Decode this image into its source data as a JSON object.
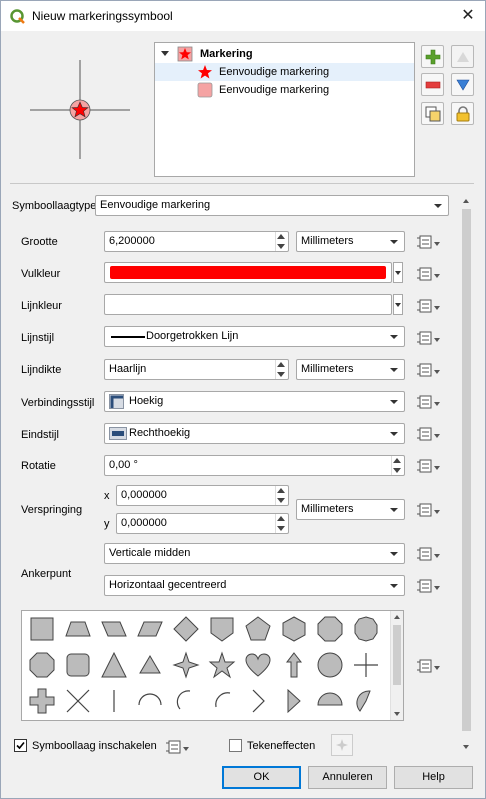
{
  "window": {
    "title": "Nieuw markeringssymbool",
    "close_glyph": "✕"
  },
  "tree": {
    "root": "Markering",
    "layers": [
      "Eenvoudige markering",
      "Eenvoudige markering"
    ]
  },
  "form": {
    "layer_type_label": "Symboollaagtype",
    "layer_type_value": "Eenvoudige markering",
    "size_label": "Grootte",
    "size_value": "6,200000",
    "size_unit": "Millimeters",
    "fill_color_label": "Vulkleur",
    "fill_color": "#ff0000",
    "stroke_color_label": "Lijnkleur",
    "stroke_style_label": "Lijnstijl",
    "stroke_style_value": "Doorgetrokken Lijn",
    "stroke_width_label": "Lijndikte",
    "stroke_width_value": "Haarlijn",
    "stroke_width_unit": "Millimeters",
    "join_style_label": "Verbindingsstijl",
    "join_style_value": "Hoekig",
    "cap_style_label": "Eindstijl",
    "cap_style_value": "Rechthoekig",
    "rotation_label": "Rotatie",
    "rotation_value": "0,00 °",
    "offset_label": "Verspringing",
    "offset_x_label": "x",
    "offset_x_value": "0,000000",
    "offset_y_label": "y",
    "offset_y_value": "0,000000",
    "offset_unit": "Millimeters",
    "anchor_label": "Ankerpunt",
    "anchor_vertical": "Verticale midden",
    "anchor_horizontal": "Horizontaal gecentreerd"
  },
  "footer": {
    "enable_layer_label": "Symboollaag inschakelen",
    "enable_layer_checked": true,
    "draw_effects_label": "Tekeneffecten",
    "draw_effects_checked": false,
    "ok": "OK",
    "cancel": "Annuleren",
    "help": "Help"
  },
  "shapes": [
    "square",
    "trapezoid",
    "parallelogram-right",
    "parallelogram-left",
    "diamond",
    "shield",
    "pentagon",
    "hexagon",
    "octagon",
    "decagon",
    "rounded-octagon",
    "rounded-square",
    "triangle",
    "equilateral-triangle",
    "four-point-star",
    "star",
    "heart",
    "arrow",
    "circle",
    "cross",
    "cross-fill",
    "x-cross",
    "line",
    "semicircle",
    "third-circle",
    "quarter-circle",
    "arrowhead",
    "filled-arrowhead",
    "half-circle-fill",
    "quarter-circle-fill"
  ],
  "colors": {
    "accent": "#0078d7",
    "marker_fill": "#ff0000",
    "layer_fill": "#f5a3a3"
  }
}
